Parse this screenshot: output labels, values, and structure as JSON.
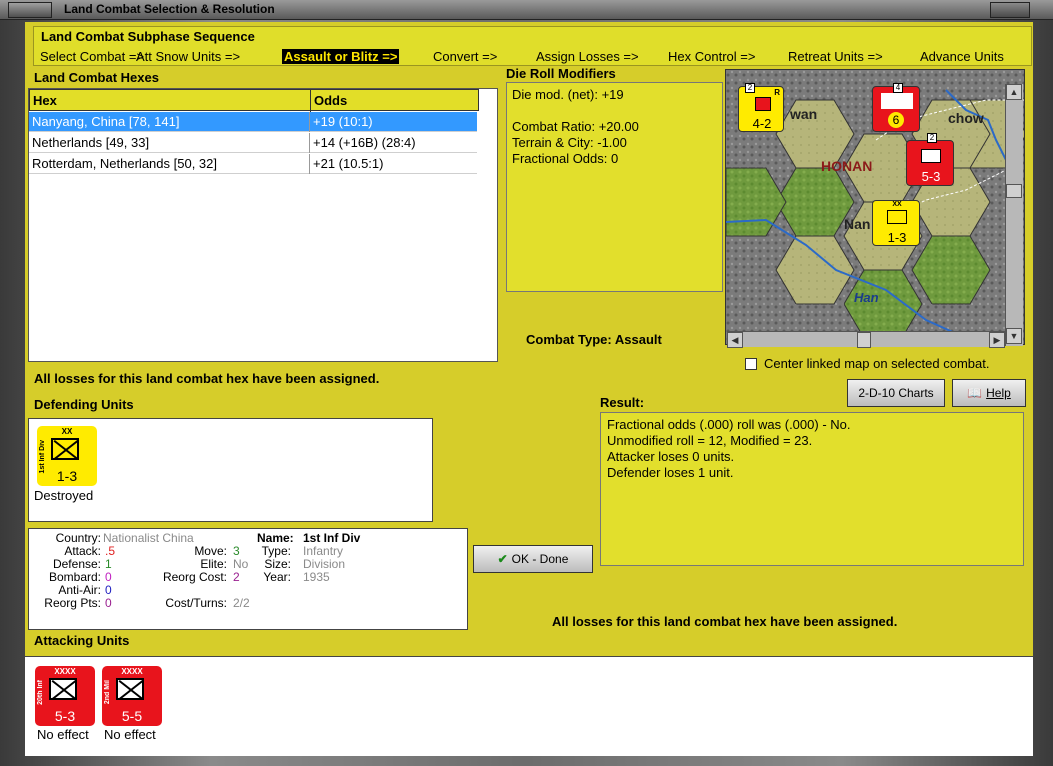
{
  "window": {
    "title": "Land Combat Selection & Resolution"
  },
  "sequence": {
    "title": "Land Combat Subphase Sequence",
    "steps": [
      "Select Combat =>",
      "Att Snow Units =>",
      "Assault or Blitz =>",
      "Convert =>",
      "Assign Losses =>",
      "Hex Control =>",
      "Retreat Units =>",
      "Advance Units"
    ],
    "active_index": 2
  },
  "hexes": {
    "title": "Land Combat Hexes",
    "col_hex": "Hex",
    "col_odds": "Odds",
    "rows": [
      {
        "hex": "Nanyang, China [78, 141]",
        "odds": "+19 (10:1)"
      },
      {
        "hex": "Netherlands [49, 33]",
        "odds": "+14 (+16B) (28:4)"
      },
      {
        "hex": "Rotterdam, Netherlands [50, 32]",
        "odds": "+21 (10.5:1)"
      }
    ]
  },
  "die": {
    "title": "Die Roll Modifiers",
    "lines": [
      "Die mod. (net): +19",
      "",
      "Combat Ratio: +20.00",
      "Terrain & City: -1.00",
      "Fractional Odds: 0"
    ]
  },
  "map": {
    "labels": {
      "honan": "HONAN",
      "han": "Han",
      "wan": "wan",
      "chow": "chow",
      "nan": "Nan"
    },
    "counters": [
      {
        "color": "#ffeb00",
        "strength": "4-2",
        "stack": "2",
        "corner": "R"
      },
      {
        "color": "#e8141c",
        "strength": "6",
        "stack": "4"
      },
      {
        "color": "#e8141c",
        "strength": "5-3",
        "stack": "2"
      },
      {
        "color": "#ffeb00",
        "strength": "1-3",
        "size": "XX"
      }
    ]
  },
  "combat_type": {
    "label": "Combat Type:",
    "value": "Assault"
  },
  "center_map": {
    "label": "Center linked map on selected combat."
  },
  "status_msg": "All losses for this land combat hex have been assigned.",
  "buttons": {
    "charts": "2-D-10 Charts",
    "help": "Help",
    "ok": "OK - Done"
  },
  "result": {
    "title": "Result:",
    "lines": [
      "Fractional odds (.000) roll was (.000)  - No.",
      "Unmodified roll = 12, Modified = 23.",
      "Attacker loses 0 units.",
      "Defender loses 1 unit."
    ]
  },
  "defending": {
    "title": "Defending Units",
    "units": [
      {
        "size": "XX",
        "side": "1st Inf Div",
        "strength": "1-3",
        "status": "Destroyed"
      }
    ]
  },
  "stats": {
    "country_label": "Country:",
    "country": "Nationalist China",
    "name_label": "Name:",
    "name": "1st Inf Div",
    "attack_label": "Attack:",
    "attack": ".5",
    "move_label": "Move:",
    "move": "3",
    "type_label": "Type:",
    "type": "Infantry",
    "defense_label": "Defense:",
    "defense": "1",
    "elite_label": "Elite:",
    "elite": "No",
    "size_label": "Size:",
    "size": "Division",
    "bombard_label": "Bombard:",
    "bombard": "0",
    "reorg_label": "Reorg Cost:",
    "reorg": "2",
    "year_label": "Year:",
    "year": "1935",
    "antiair_label": "Anti-Air:",
    "antiair": "0",
    "reorgpts_label": "Reorg Pts:",
    "reorgpts": "0",
    "costturns_label": "Cost/Turns:",
    "costturns": "2/2"
  },
  "bottom_msg": "All losses for this land combat hex have been assigned.",
  "attacking": {
    "title": "Attacking Units",
    "units": [
      {
        "size": "XXXX",
        "side": "20th Inf",
        "strength": "5-3",
        "status": "No effect"
      },
      {
        "size": "XXXX",
        "side": "2nd Mil",
        "strength": "5-5",
        "status": "No effect"
      }
    ]
  }
}
